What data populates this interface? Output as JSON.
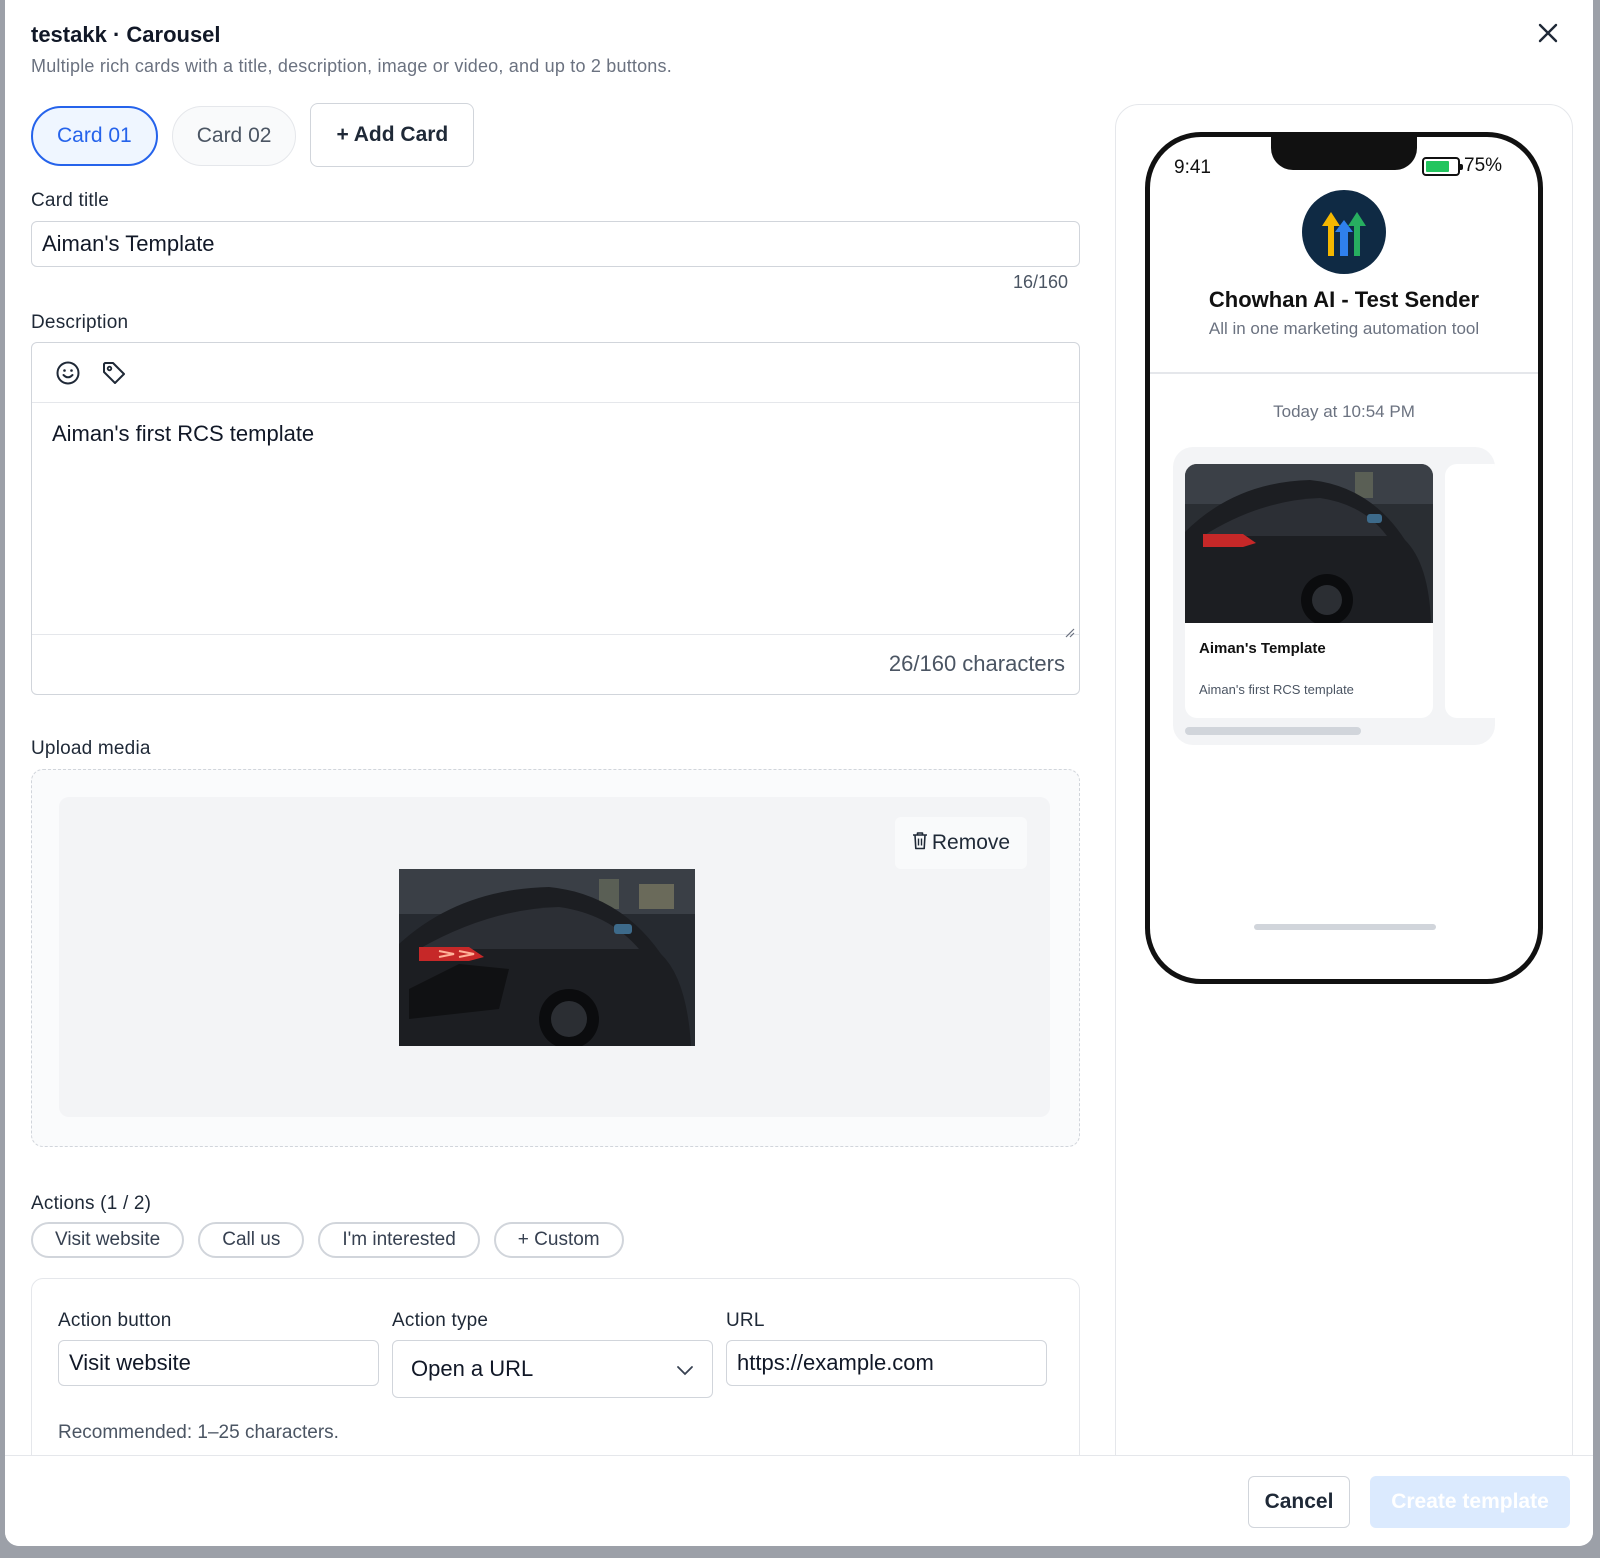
{
  "header": {
    "title": "testakk · Carousel",
    "subtitle": "Multiple rich cards with a title, description, image or video, and up to 2 buttons.",
    "close_icon": "close-icon"
  },
  "tabs": [
    {
      "label": "Card 01",
      "active": true
    },
    {
      "label": "Card 02",
      "active": false
    }
  ],
  "add_card_label": "+ Add Card",
  "card_title": {
    "label": "Card title",
    "value": "Aiman's Template",
    "counter": "16/160"
  },
  "description": {
    "label": "Description",
    "value": "Aiman's first RCS template",
    "counter": "26/160 characters",
    "toolbar_icons": [
      "emoji-icon",
      "tag-icon"
    ]
  },
  "upload": {
    "label": "Upload media",
    "remove_label": "Remove",
    "remove_icon": "trash-icon"
  },
  "actions": {
    "label": "Actions (1 / 2)",
    "chips": [
      "Visit website",
      "Call us",
      "I'm interested",
      "+ Custom"
    ],
    "button_label": "Action button",
    "button_value": "Visit website",
    "type_label": "Action type",
    "type_value": "Open a URL",
    "url_label": "URL",
    "url_value": "https://example.com",
    "hint": "Recommended: 1–25 characters."
  },
  "footer": {
    "cancel_label": "Cancel",
    "create_label": "Create template"
  },
  "preview": {
    "time": "9:41",
    "battery": "75%",
    "battery_level": 0.75,
    "sender_name": "Chowhan AI - Test Sender",
    "sender_sub": "All in one marketing automation tool",
    "message_time": "Today at 10:54 PM",
    "card_title": "Aiman's Template",
    "card_desc": "Aiman's first RCS template"
  },
  "colors": {
    "accent": "#2563eb",
    "create_disabled": "#dbeafe",
    "battery": "#22c55e"
  }
}
